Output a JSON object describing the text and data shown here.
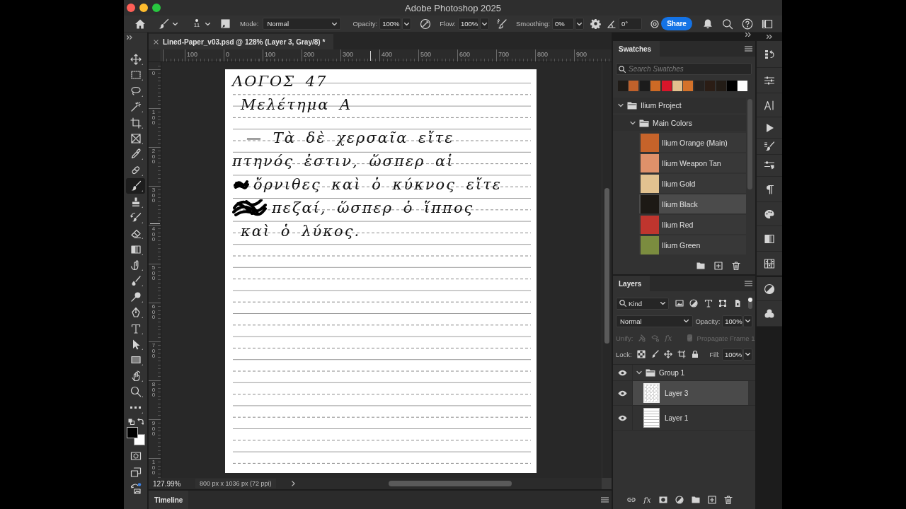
{
  "window": {
    "title": "Adobe Photoshop 2025"
  },
  "options_bar": {
    "brush_size": "11",
    "mode": {
      "label": "Mode:",
      "value": "Normal"
    },
    "opacity": {
      "label": "Opacity:",
      "value": "100%"
    },
    "flow": {
      "label": "Flow:",
      "value": "100%"
    },
    "smoothing": {
      "label": "Smoothing:",
      "value": "0%"
    },
    "angle": "0°",
    "share_button": "Share"
  },
  "document_tab": {
    "title": "Lined-Paper_v03.psd @ 128% (Layer 3, Gray/8) *"
  },
  "rulers": {
    "horizontal": [
      "100",
      "0",
      "100",
      "200",
      "300",
      "400",
      "500",
      "600",
      "700",
      "800",
      "900"
    ],
    "vertical": [
      "0",
      "100",
      "200",
      "300",
      "400",
      "500",
      "600",
      "700",
      "800",
      "900",
      "100"
    ]
  },
  "document": {
    "lines": [
      {
        "kind": "text",
        "text": "ΛΟΓΟΣ 47"
      },
      {
        "kind": "text",
        "text": "Μελέτημα Α"
      },
      {
        "kind": "text",
        "text": "— Τὰ δὲ χερσαῖα εἴτε"
      },
      {
        "kind": "text",
        "text": "πτηνός ἐστιν, ὥσπερ αἱ"
      },
      {
        "kind": "small_scribble",
        "text": "ὄρνιθες καὶ ὁ κύκνος εἴτε"
      },
      {
        "kind": "large_scribble",
        "text": "πεζαί, ὥσπερ ὁ ἵππος"
      },
      {
        "kind": "text",
        "text": "καὶ ὁ λύκος."
      }
    ]
  },
  "tools": [
    {
      "kind": "move",
      "selected": false
    },
    {
      "kind": "marquee",
      "selected": false
    },
    {
      "kind": "lasso",
      "selected": false
    },
    {
      "kind": "magic_wand",
      "selected": false
    },
    {
      "kind": "crop",
      "selected": false
    },
    {
      "kind": "frame",
      "selected": false
    },
    {
      "kind": "eyedropper",
      "selected": false
    },
    {
      "kind": "healing",
      "selected": false
    },
    {
      "kind": "brush",
      "selected": true
    },
    {
      "kind": "stamp",
      "selected": false
    },
    {
      "kind": "history_brush",
      "selected": false
    },
    {
      "kind": "eraser",
      "selected": false
    },
    {
      "kind": "gradient",
      "selected": false
    },
    {
      "kind": "smudge",
      "selected": false
    },
    {
      "kind": "sponge",
      "selected": false
    },
    {
      "kind": "dodge",
      "selected": false
    },
    {
      "kind": "pen",
      "selected": false
    },
    {
      "kind": "type",
      "selected": false
    },
    {
      "kind": "path_select",
      "selected": false
    },
    {
      "kind": "rectangle",
      "selected": false
    },
    {
      "kind": "rotate_view",
      "selected": false
    },
    {
      "kind": "zoom",
      "selected": false
    },
    {
      "kind": "more",
      "selected": false
    }
  ],
  "colors": {
    "foreground": {
      "color": "#000000"
    },
    "background": {
      "color": "#ffffff"
    }
  },
  "status_bar": {
    "zoom": "127.99%",
    "info": "800 px x 1036 px (72 ppi)"
  },
  "timeline": {
    "tab": "Timeline"
  },
  "swatches": {
    "tab": "Swatches",
    "search": {
      "placeholder": "Search Swatches"
    },
    "recent": [
      {
        "color": "#1f1b17"
      },
      {
        "color": "#c0612b"
      },
      {
        "color": "#1b1b1b"
      },
      {
        "color": "#cd6a25"
      },
      {
        "color": "#d8162a"
      },
      {
        "color": "#e2c18e"
      },
      {
        "color": "#d4722a"
      },
      {
        "color": "#252220"
      },
      {
        "color": "#2b1d15"
      },
      {
        "color": "#231c16"
      },
      {
        "color": "#000000"
      },
      {
        "color": "#ffffff"
      }
    ],
    "groups": [
      {
        "name": "Ilium Project",
        "expanded": true,
        "children": [
          {
            "name": "Main Colors",
            "expanded": true,
            "swatches": [
              {
                "name": "Ilium Orange (Main)",
                "color": "#c6632a",
                "selected": false
              },
              {
                "name": "Ilium Weapon Tan",
                "color": "#df916a",
                "selected": false
              },
              {
                "name": "Ilium Gold",
                "color": "#e2c290",
                "selected": false
              },
              {
                "name": "Ilium Black",
                "color": "#1d1915",
                "selected": true
              },
              {
                "name": "Ilium Red",
                "color": "#bf352e",
                "selected": false
              },
              {
                "name": "Ilium Green",
                "color": "#7b8c3f",
                "selected": false
              }
            ]
          }
        ]
      }
    ]
  },
  "layers": {
    "tab": "Layers",
    "filter_kind": "Kind",
    "filter_toggle": {
      "on": true
    },
    "blend_mode": "Normal",
    "opacity": {
      "label": "Opacity:",
      "value": "100%"
    },
    "unify": {
      "label": "Unify:",
      "fx": "fx",
      "disabled": true
    },
    "propagate": {
      "label": "Propagate Frame 1",
      "checked": true,
      "disabled": true
    },
    "lock": {
      "label": "Lock:"
    },
    "fill": {
      "label": "Fill:",
      "value": "100%"
    },
    "items": [
      {
        "kind": "group",
        "name": "Group 1",
        "visible": true,
        "expanded": true,
        "selected": false,
        "children": [
          {
            "kind": "transparent_layer",
            "name": "Layer 3",
            "visible": true,
            "selected": true
          },
          {
            "kind": "lined_layer",
            "name": "Layer 1",
            "visible": true,
            "selected": false
          }
        ]
      }
    ],
    "footer_fx": "fx"
  }
}
